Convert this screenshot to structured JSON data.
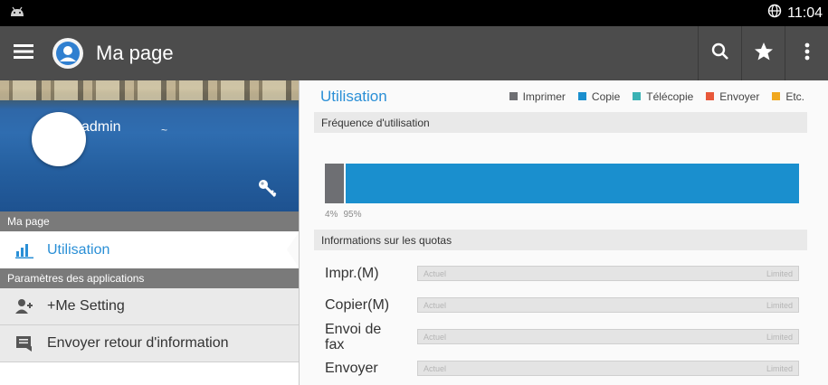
{
  "status_bar": {
    "time": "11:04",
    "notification_icon": "android-icon",
    "network_icon": "globe-icon"
  },
  "action_bar": {
    "title": "Ma page",
    "menu_icon": "hamburger-icon",
    "search_icon": "search-icon",
    "favorite_icon": "star-icon",
    "overflow_icon": "overflow-menu-icon"
  },
  "profile": {
    "name": "admin",
    "key_icon": "key-icon"
  },
  "sidebar": {
    "section1": "Ma page",
    "selected_item": "Utilisation",
    "section2": "Paramètres des applications",
    "items": [
      {
        "label": "+Me Setting",
        "icon": "user-setting-icon"
      },
      {
        "label": "Envoyer retour d'information",
        "icon": "feedback-icon"
      }
    ]
  },
  "main": {
    "title": "Utilisation",
    "legend": [
      {
        "label": "Imprimer",
        "color": "#6e6f73"
      },
      {
        "label": "Copie",
        "color": "#1a8fce"
      },
      {
        "label": "Télécopie",
        "color": "#3ab2b4"
      },
      {
        "label": "Envoyer",
        "color": "#e8583a"
      },
      {
        "label": "Etc.",
        "color": "#f0a81e"
      }
    ],
    "frequency_header": "Fréquence d'utilisation",
    "usage": {
      "segments": [
        {
          "label": "4%",
          "fraction": 0.04,
          "color": "#6e6f73"
        },
        {
          "label": "95%",
          "fraction": 0.96,
          "color": "#1a8fce"
        }
      ]
    },
    "quota_header": "Informations sur les quotas",
    "quotas": [
      {
        "label": "Impr.(M)",
        "current": "Actuel",
        "limit": "Limited"
      },
      {
        "label": "Copier(M)",
        "current": "Actuel",
        "limit": "Limited"
      },
      {
        "label": "Envoi de fax",
        "current": "Actuel",
        "limit": "Limited"
      },
      {
        "label": "Envoyer",
        "current": "Actuel",
        "limit": "Limited"
      }
    ]
  }
}
